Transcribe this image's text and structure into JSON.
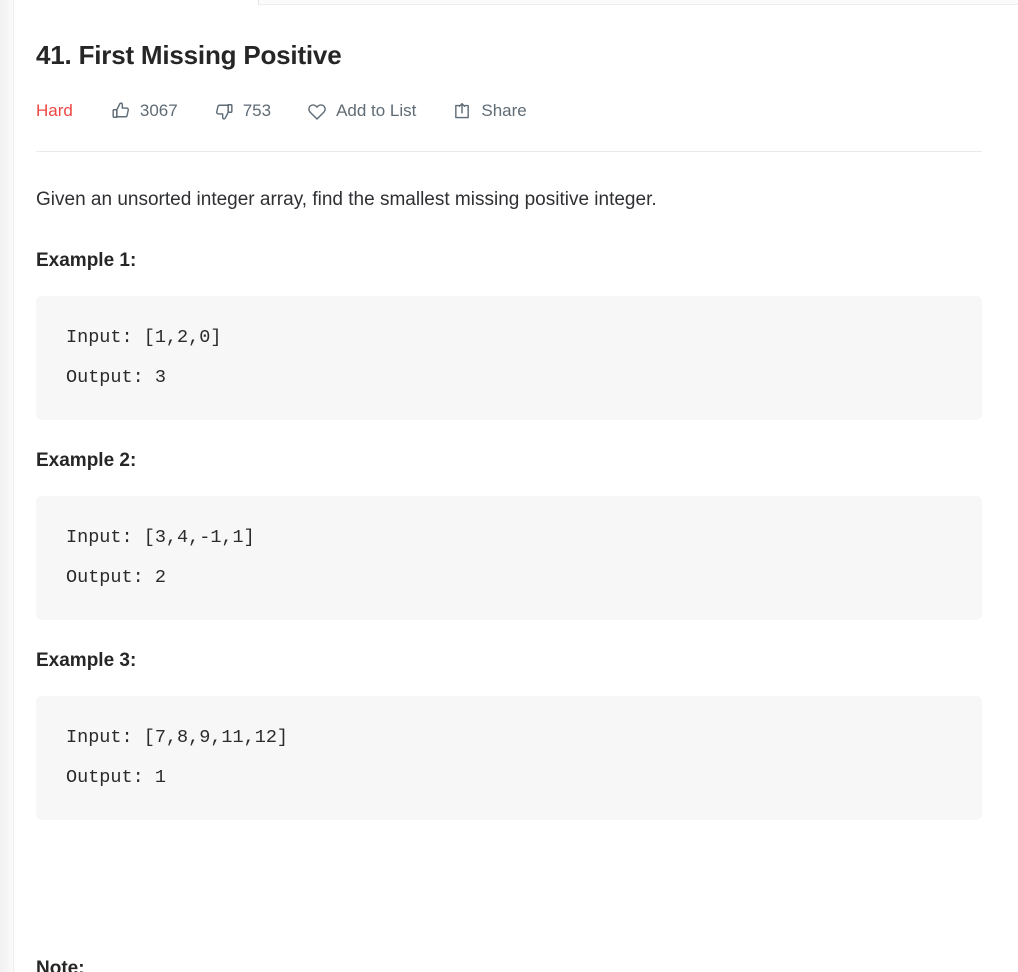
{
  "window": {
    "background_color": "#ffffff",
    "accent_color": "#ef4743",
    "text_color": "#262626",
    "muted_text_color": "#5f6b75",
    "code_background": "#f7f7f7"
  },
  "problem": {
    "title": "41. First Missing Positive",
    "difficulty": "Hard",
    "description": "Given an unsorted integer array, find the smallest missing positive integer."
  },
  "actions": {
    "likes": {
      "icon": "thumbs-up-icon",
      "count": "3067"
    },
    "dislikes": {
      "icon": "thumbs-down-icon",
      "count": "753"
    },
    "add_to_list": {
      "icon": "heart-icon",
      "label": "Add to List"
    },
    "share": {
      "icon": "share-icon",
      "label": "Share"
    }
  },
  "examples": [
    {
      "heading": "Example 1:",
      "code": "Input: [1,2,0]\nOutput: 3",
      "input": "[1,2,0]",
      "output": "3"
    },
    {
      "heading": "Example 2:",
      "code": "Input: [3,4,-1,1]\nOutput: 2",
      "input": "[3,4,-1,1]",
      "output": "2"
    },
    {
      "heading": "Example 3:",
      "code": "Input: [7,8,9,11,12]\nOutput: 1",
      "input": "[7,8,9,11,12]",
      "output": "1"
    }
  ],
  "clipped_section": {
    "heading": "Note:"
  }
}
